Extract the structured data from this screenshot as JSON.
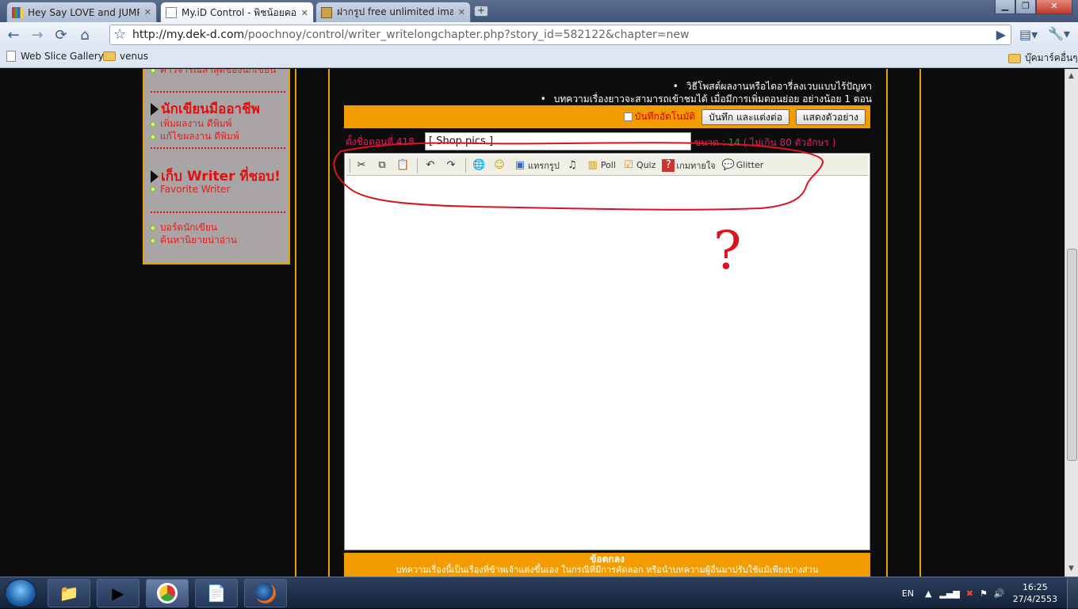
{
  "browser": {
    "tabs": [
      {
        "title": "Hey Say LOVE and JUMP!",
        "active": false
      },
      {
        "title": "My.iD Control - พิชน้อยคอ...",
        "active": true
      },
      {
        "title": "ฝากรูป free unlimited ima...",
        "active": false
      }
    ],
    "url_host": "http://my.dek-d.com",
    "url_path": "/poochnoy/control/writer_writelongchapter.php?story_id=582122&chapter=new",
    "bookmarks": [
      "Web Slice Gallery",
      "venus"
    ],
    "other_bookmarks": "บุ๊คมาร์คอื่นๆ"
  },
  "sidebar": {
    "partial_top": "คำวิจารณ์ล่าสุดของนักเขียน",
    "pro_heading": "นักเขียนมืออาชีพ",
    "pro_links": [
      "เพิ่มผลงาน ดีพิมพ์",
      "แก้ไขผลงาน ดีพิมพ์"
    ],
    "fav_heading": "เก็บ Writer ที่ชอบ!",
    "fav_links": [
      "Favorite Writer"
    ],
    "other_links": [
      "บอร์ดนักเขียน",
      "ค้นหานิยายน่าอ่าน"
    ]
  },
  "notes": [
    "วิธีโพสต์ผลงานหรือไดอารี่ลงเวบแบบไร้ปัญหา",
    "บทความเรื่องยาวจะสามารถเข้าชมได้ เมื่อมีการเพิ่มตอนย่อย อย่างน้อย 1 ตอน"
  ],
  "actions": {
    "autosave": "บันทึกอัตโนมัติ",
    "save_continue": "บันทึก และแต่งต่อ",
    "preview": "แสดงตัวอย่าง"
  },
  "chapter": {
    "label": "ตั้งชื่อตอนที่ 418",
    "title_value": "[ Shop pics ]",
    "size_label": "ขนาด :",
    "size_value": "14",
    "size_limit": "( ไม่เกิน 80 ตัวอักษร )"
  },
  "editor_toolbar": {
    "insert_image": "แทรกรูป",
    "poll": "Poll",
    "quiz": "Quiz",
    "game": "เกมทายใจ",
    "glitter": "Glitter"
  },
  "annotation": "?",
  "footer": {
    "title": "ข้อตกลง",
    "text": "บทความเรื่องนี้เป็นเรื่องที่ข้าพเจ้าแต่งขึ้นเอง ในกรณีที่มีการคัดลอก หรือนำบทความผู้อื่นมาปรับใช้แม้เพียงบางส่วน"
  },
  "taskbar": {
    "lang": "EN",
    "time": "16:25",
    "date": "27/4/2553"
  }
}
